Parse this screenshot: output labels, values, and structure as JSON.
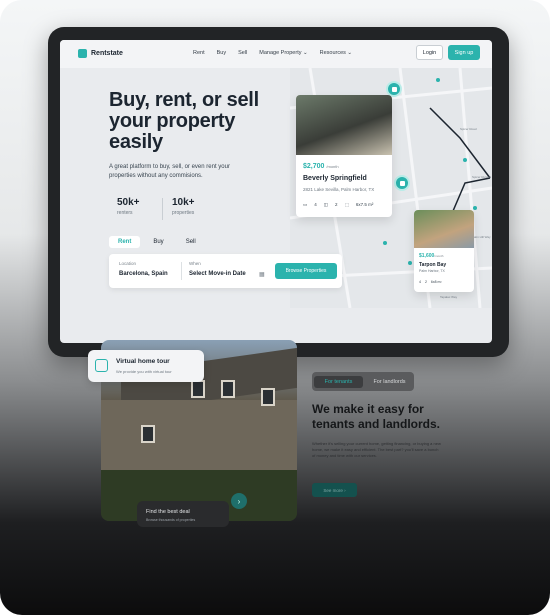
{
  "nav": {
    "brand": "Rentstate",
    "items": [
      "Rent",
      "Buy",
      "Sell",
      "Manage Property ⌄",
      "Resources ⌄"
    ],
    "login": "Login",
    "signup": "Sign up"
  },
  "hero": {
    "title": "Buy, rent, or sell your property easily",
    "subtitle": "A great platform to buy, sell, or even rent your properties without any commisions.",
    "stats": [
      {
        "value": "50k+",
        "label": "renters"
      },
      {
        "value": "10k+",
        "label": "properties"
      }
    ],
    "tabs": [
      "Rent",
      "Buy",
      "Sell"
    ],
    "search": {
      "location_label": "Location",
      "location_value": "Barcelona, Spain",
      "when_label": "When",
      "when_value": "Select Move-in Date",
      "button": "Browse Properties"
    }
  },
  "listing_main": {
    "price": "$2,700",
    "price_unit": "/month",
    "name": "Beverly Springfield",
    "address": "2821 Lake Sevilla, Palm Harbor, TX",
    "beds": "4",
    "baths": "2",
    "area": "6x7.5 m²"
  },
  "listing_small": {
    "price": "$1,600",
    "price_unit": "/month",
    "name": "Tarpon Bay",
    "address": "Palm Harbor, TX",
    "beds": "4",
    "baths": "2",
    "area": "6x8 m²"
  },
  "map": {
    "street_labels": [
      "Spicer Road",
      "Spicer Ruland",
      "Baker Road",
      "Palm Hill Way",
      "Tapalac Way"
    ]
  },
  "lower": {
    "tour_title": "Virtual home tour",
    "tour_sub": "We provide you with virtual tour",
    "deal_title": "Find the best deal",
    "deal_sub": "Browse thousands of properties",
    "segments": [
      "For tenants",
      "For landlords"
    ],
    "title": "We make it easy for tenants and landlords.",
    "description": "Whether it's selling your current home, getting financing, or buying a new home, we make it easy and efficient. The best part? you'll save a bunch of money and time with our services.",
    "cta": "See more ›"
  },
  "colors": {
    "accent": "#2bb3ad",
    "ink": "#1c2530"
  }
}
